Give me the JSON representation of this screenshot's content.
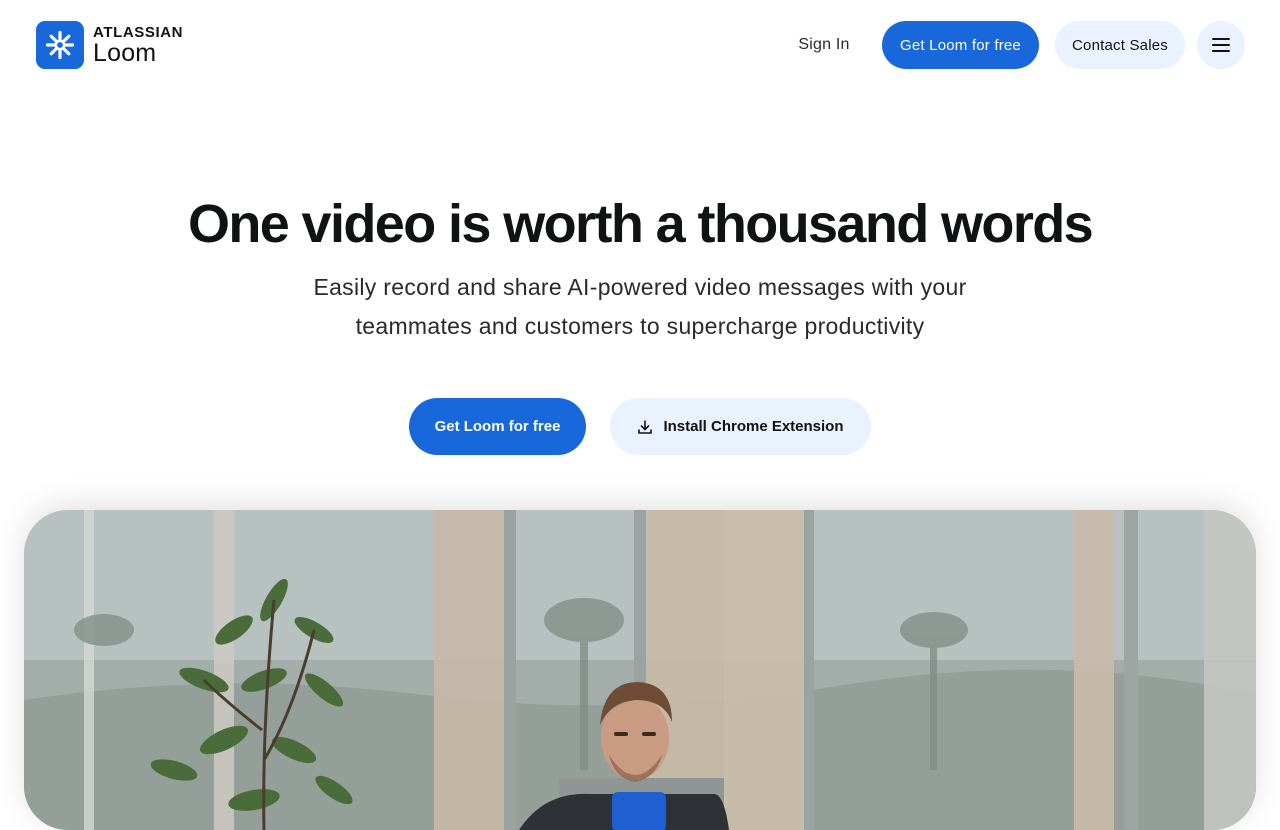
{
  "header": {
    "logo": {
      "company": "ATLASSIAN",
      "product": "Loom",
      "icon": "loom-asterisk-icon"
    },
    "sign_in_label": "Sign In",
    "get_loom_label": "Get Loom for free",
    "contact_sales_label": "Contact Sales",
    "menu_icon": "hamburger-menu-icon"
  },
  "hero": {
    "title": "One video is worth a thousand words",
    "subtitle_line1": "Easily record and share AI-powered video messages with your",
    "subtitle_line2": "teammates and customers to supercharge productivity",
    "primary_cta_label": "Get Loom for free",
    "secondary_cta_label": "Install Chrome Extension",
    "secondary_cta_icon": "download-icon"
  },
  "video": {
    "content": "office-scene-person-at-desk"
  },
  "colors": {
    "brand_blue": "#1868db",
    "soft_blue": "#e9f2fe",
    "text_dark": "#101214"
  }
}
